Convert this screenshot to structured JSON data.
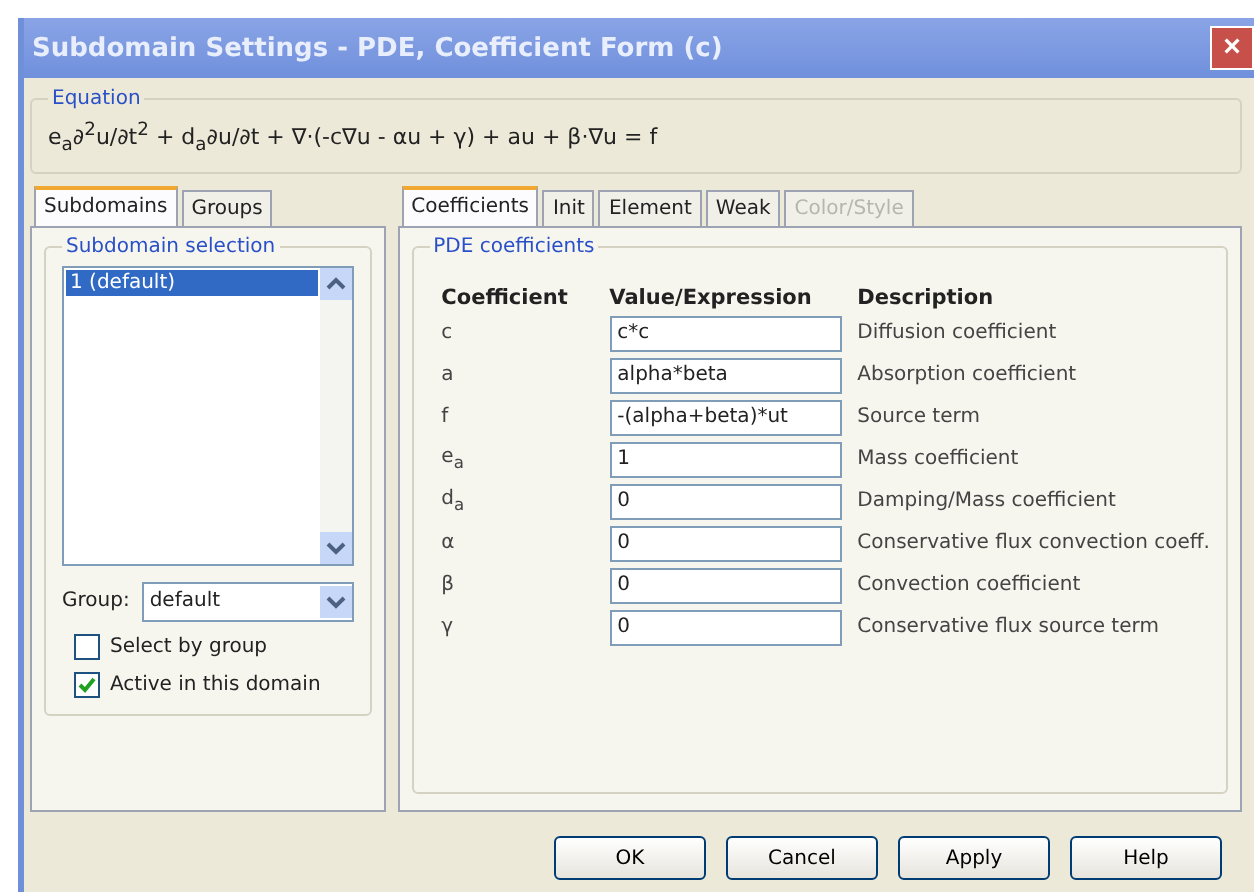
{
  "window": {
    "title": "Subdomain Settings - PDE, Coefficient Form (c)",
    "close": "×"
  },
  "equation": {
    "legend": "Equation",
    "text": "e$_{a}$∂$^{2}$u/∂t$^{2}$ + d$_{a}$∂u/∂t + ∇·(-c∇u - αu + γ) + au + β·∇u = f"
  },
  "left_tabs": [
    {
      "label": "Subdomains",
      "selected": true
    },
    {
      "label": "Groups",
      "selected": false
    }
  ],
  "subdomain_selection": {
    "legend": "Subdomain selection",
    "items": [
      {
        "label": "1 (default)",
        "selected": true
      }
    ],
    "group_label": "Group:",
    "group_value": "default",
    "checkboxes": [
      {
        "label": "Select by group",
        "checked": false
      },
      {
        "label": "Active in this domain",
        "checked": true
      }
    ]
  },
  "right_tabs": [
    {
      "label": "Coefficients",
      "selected": true,
      "disabled": false
    },
    {
      "label": "Init",
      "selected": false,
      "disabled": false
    },
    {
      "label": "Element",
      "selected": false,
      "disabled": false
    },
    {
      "label": "Weak",
      "selected": false,
      "disabled": false
    },
    {
      "label": "Color/Style",
      "selected": false,
      "disabled": true
    }
  ],
  "pde": {
    "legend": "PDE coefficients",
    "columns": [
      "Coefficient",
      "Value/Expression",
      "Description"
    ],
    "rows": [
      {
        "symbol": "c",
        "value": "c*c",
        "description": "Diffusion coefficient"
      },
      {
        "symbol": "a",
        "value": "alpha*beta",
        "description": "Absorption coefficient"
      },
      {
        "symbol": "f",
        "value": "-(alpha+beta)*ut",
        "description": "Source term"
      },
      {
        "symbol": "e$_{a}$",
        "value": "1",
        "description": "Mass coefficient"
      },
      {
        "symbol": "d$_{a}$",
        "value": "0",
        "description": "Damping/Mass coefficient"
      },
      {
        "symbol": "α",
        "value": "0",
        "description": "Conservative flux convection coeff."
      },
      {
        "symbol": "β",
        "value": "0",
        "description": "Convection coefficient"
      },
      {
        "symbol": "γ",
        "value": "0",
        "description": "Conservative flux source term"
      }
    ]
  },
  "buttons": [
    "OK",
    "Cancel",
    "Apply",
    "Help"
  ]
}
